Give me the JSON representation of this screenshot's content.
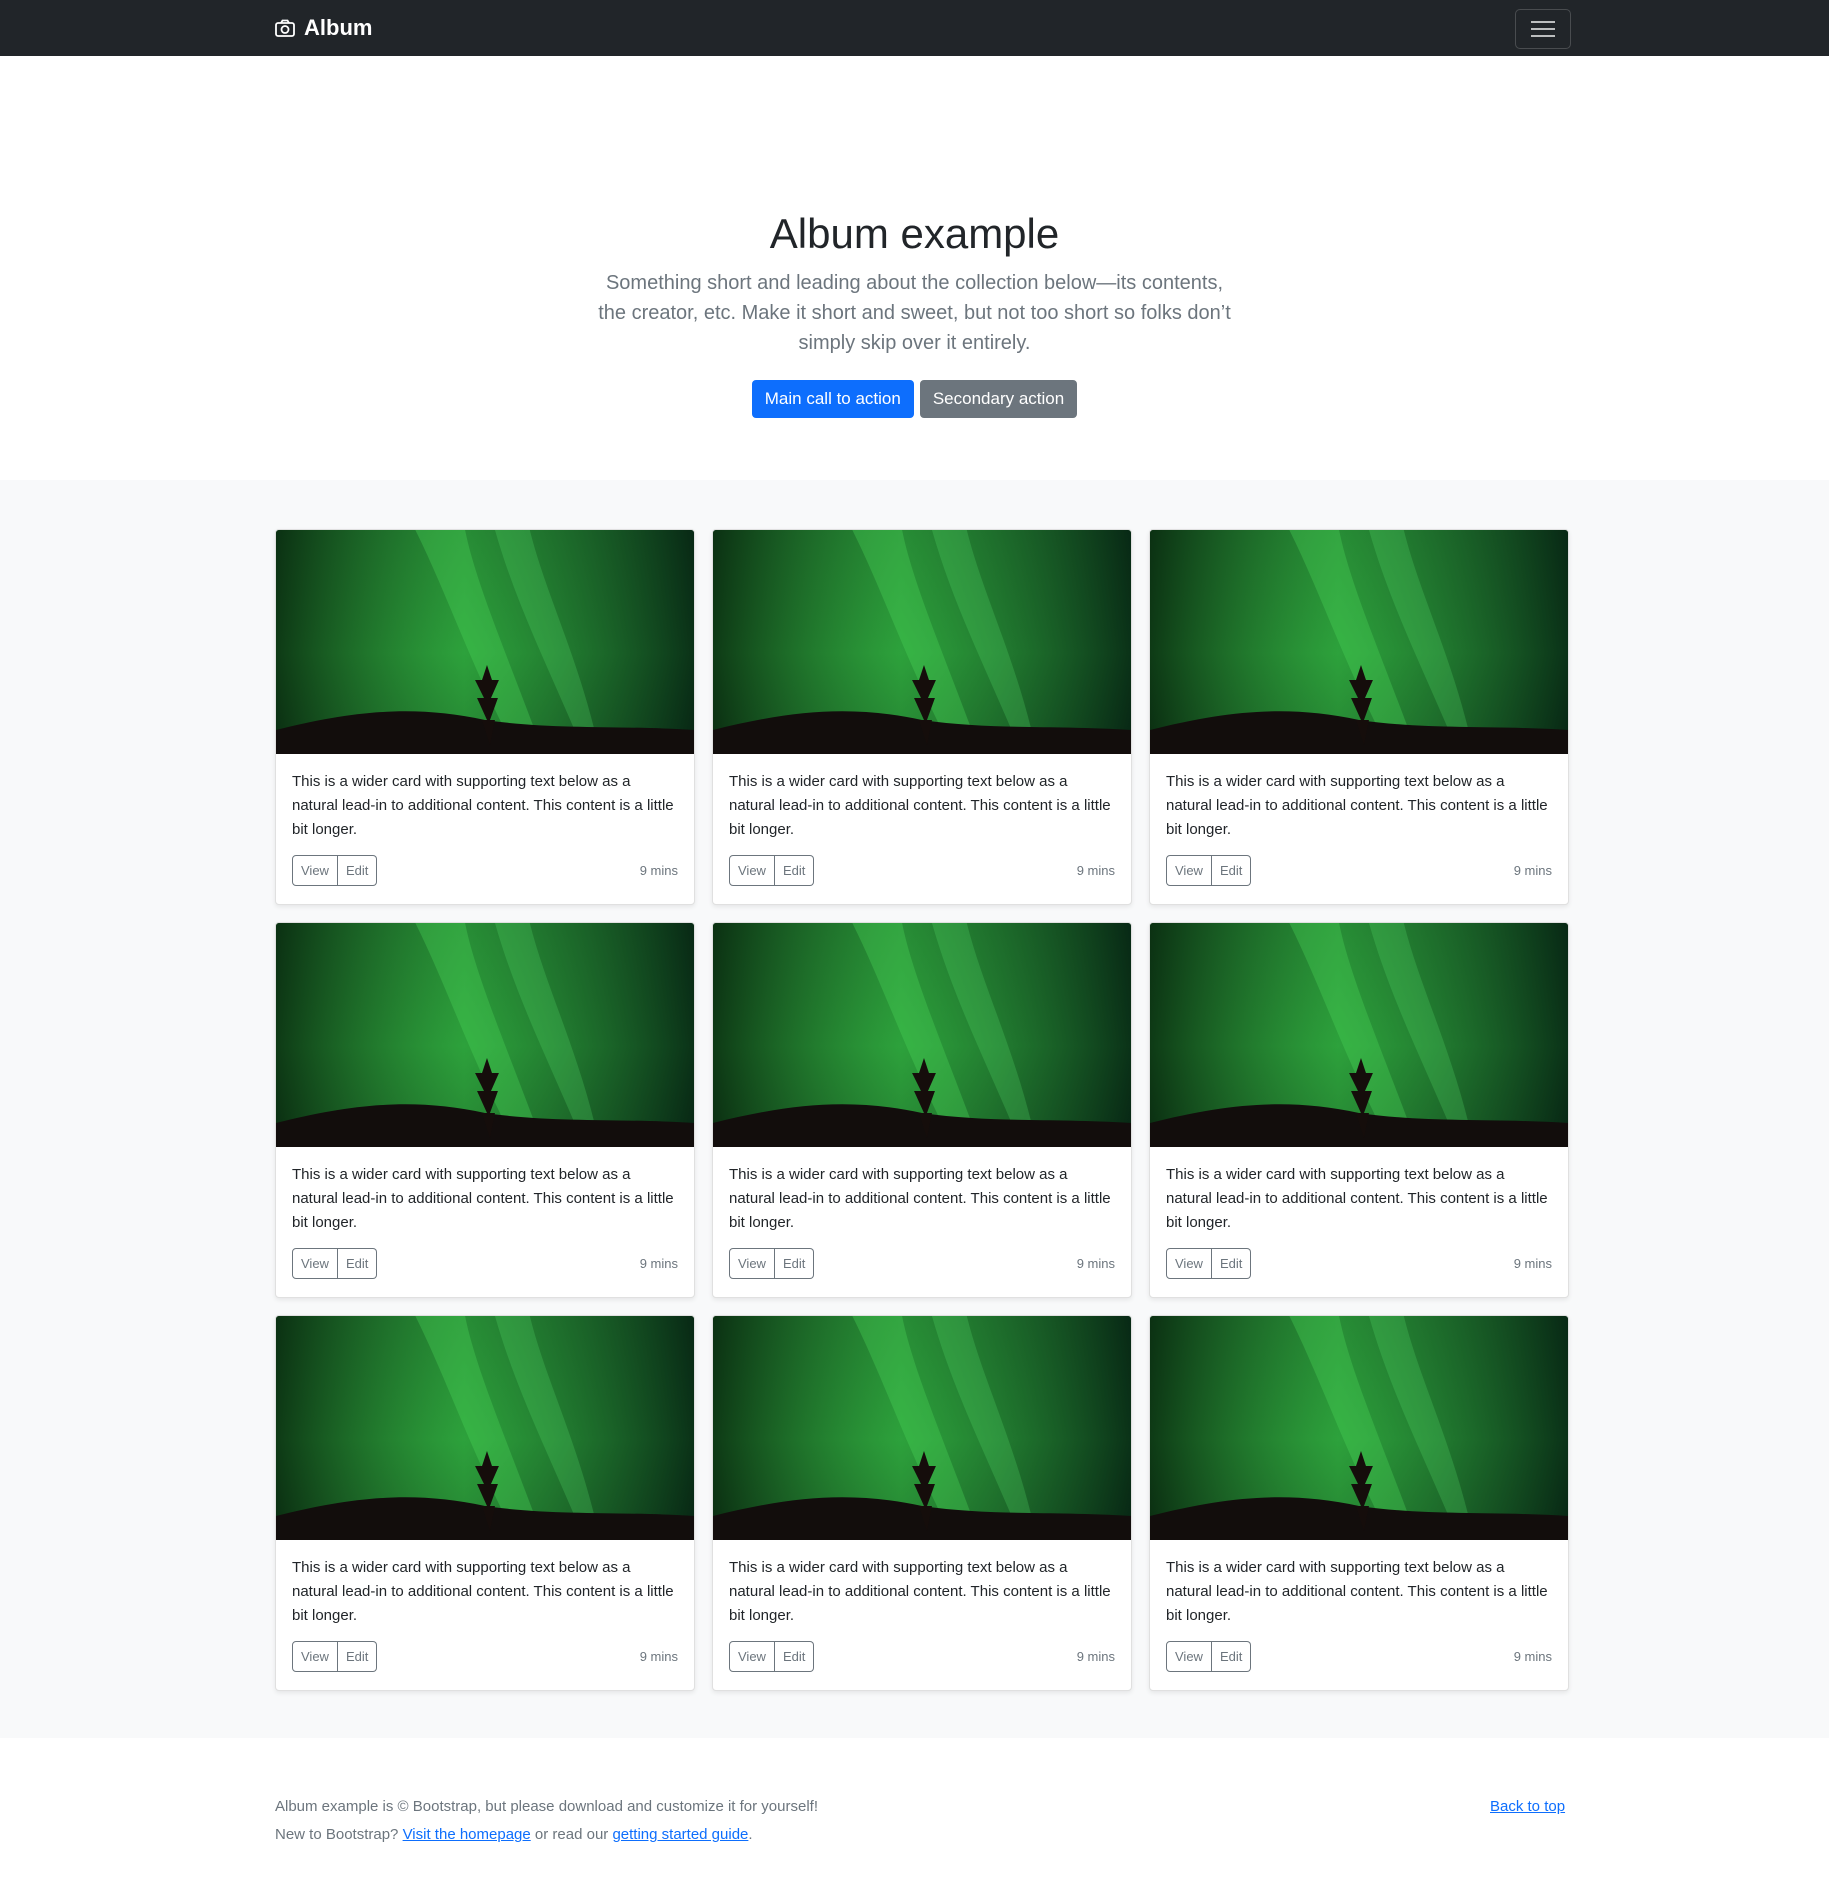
{
  "navbar": {
    "brand": "Album",
    "brand_icon": "camera-icon",
    "toggler_icon": "hamburger-menu-icon"
  },
  "hero": {
    "title": "Album example",
    "lead": "Something short and leading about the collection below—its contents, the creator, etc. Make it short and sweet, but not too short so folks don’t simply skip over it entirely.",
    "primary_action": "Main call to action",
    "secondary_action": "Secondary action"
  },
  "cards": [
    {
      "text": "This is a wider card with supporting text below as a natural lead-in to additional content. This content is a little bit longer.",
      "view": "View",
      "edit": "Edit",
      "time": "9 mins"
    },
    {
      "text": "This is a wider card with supporting text below as a natural lead-in to additional content. This content is a little bit longer.",
      "view": "View",
      "edit": "Edit",
      "time": "9 mins"
    },
    {
      "text": "This is a wider card with supporting text below as a natural lead-in to additional content. This content is a little bit longer.",
      "view": "View",
      "edit": "Edit",
      "time": "9 mins"
    },
    {
      "text": "This is a wider card with supporting text below as a natural lead-in to additional content. This content is a little bit longer.",
      "view": "View",
      "edit": "Edit",
      "time": "9 mins"
    },
    {
      "text": "This is a wider card with supporting text below as a natural lead-in to additional content. This content is a little bit longer.",
      "view": "View",
      "edit": "Edit",
      "time": "9 mins"
    },
    {
      "text": "This is a wider card with supporting text below as a natural lead-in to additional content. This content is a little bit longer.",
      "view": "View",
      "edit": "Edit",
      "time": "9 mins"
    },
    {
      "text": "This is a wider card with supporting text below as a natural lead-in to additional content. This content is a little bit longer.",
      "view": "View",
      "edit": "Edit",
      "time": "9 mins"
    },
    {
      "text": "This is a wider card with supporting text below as a natural lead-in to additional content. This content is a little bit longer.",
      "view": "View",
      "edit": "Edit",
      "time": "9 mins"
    },
    {
      "text": "This is a wider card with supporting text below as a natural lead-in to additional content. This content is a little bit longer.",
      "view": "View",
      "edit": "Edit",
      "time": "9 mins"
    }
  ],
  "footer": {
    "line1": "Album example is © Bootstrap, but please download and customize it for yourself!",
    "line2_prefix": "New to Bootstrap?",
    "homepage_link": "Visit the homepage",
    "line2_middle": "or read our",
    "guide_link": "getting started guide",
    "line2_suffix": ".",
    "back_to_top": "Back to top"
  },
  "colors": {
    "navbar_bg": "#212529",
    "primary": "#0d6efd",
    "secondary": "#6c757d",
    "album_bg": "#f8f9fa"
  }
}
